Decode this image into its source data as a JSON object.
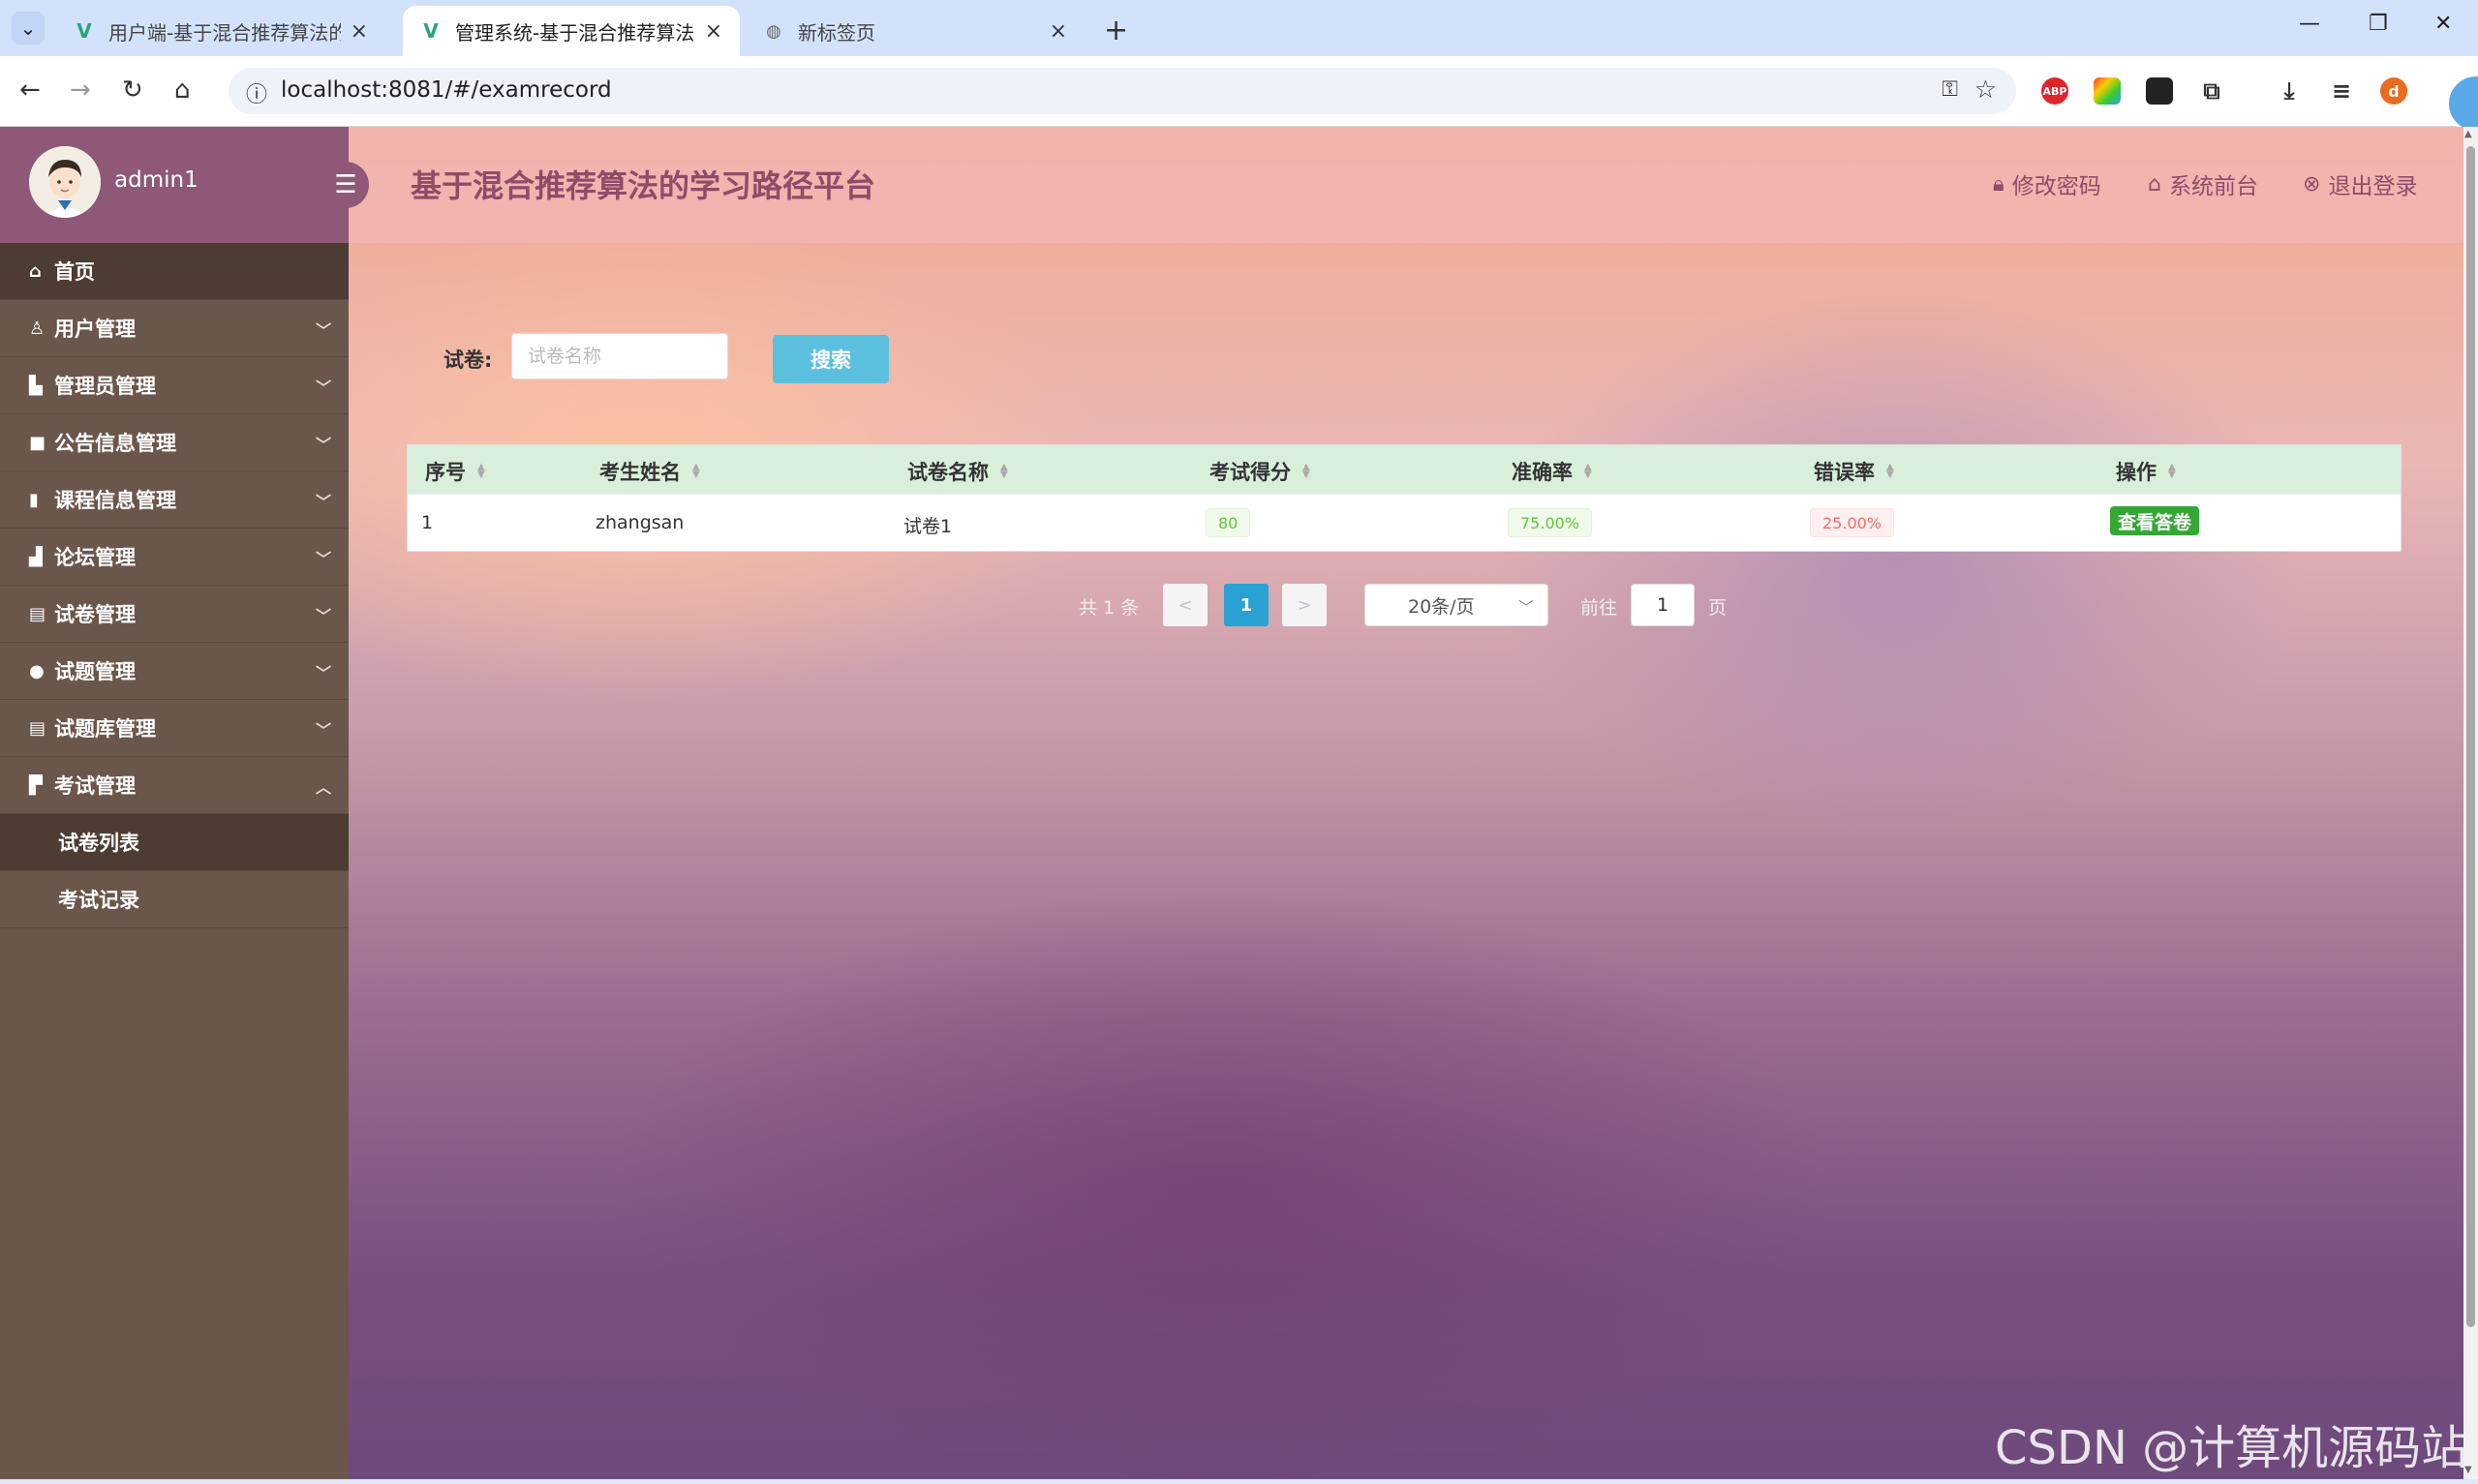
{
  "browser": {
    "tabs": [
      {
        "title": "用户端-基于混合推荐算法的学习路径平台",
        "active": false
      },
      {
        "title": "管理系统-基于混合推荐算法的学习路径平台",
        "active": true
      },
      {
        "title": "新标签页",
        "active": false
      }
    ],
    "url": "localhost:8081/#/examrecord",
    "profile_initial": "d",
    "ext_abp": "ABP"
  },
  "sidebar": {
    "username": "admin1",
    "menu": [
      {
        "label": "首页",
        "icon": "home-icon"
      },
      {
        "label": "用户管理",
        "icon": "user-icon"
      },
      {
        "label": "管理员管理",
        "icon": "admin-icon"
      },
      {
        "label": "公告信息管理",
        "icon": "notice-icon"
      },
      {
        "label": "课程信息管理",
        "icon": "course-icon"
      },
      {
        "label": "论坛管理",
        "icon": "forum-icon"
      },
      {
        "label": "试卷管理",
        "icon": "paper-icon"
      },
      {
        "label": "试题管理",
        "icon": "question-icon"
      },
      {
        "label": "试题库管理",
        "icon": "bank-icon"
      },
      {
        "label": "考试管理",
        "icon": "exam-icon"
      }
    ],
    "submenu": [
      {
        "label": "试卷列表"
      },
      {
        "label": "考试记录"
      }
    ]
  },
  "header": {
    "title": "基于混合推荐算法的学习路径平台",
    "change_password": "修改密码",
    "front_desk": "系统前台",
    "logout": "退出登录"
  },
  "search": {
    "label": "试卷:",
    "placeholder": "试卷名称",
    "button": "搜索"
  },
  "table": {
    "columns": [
      "序号",
      "考生姓名",
      "试卷名称",
      "考试得分",
      "准确率",
      "错误率",
      "操作"
    ],
    "rows": [
      {
        "index": "1",
        "name": "zhangsan",
        "paper": "试卷1",
        "score": "80",
        "accuracy": "75.00%",
        "error_rate": "25.00%",
        "action": "查看答卷"
      }
    ]
  },
  "pagination": {
    "total": "共 1 条",
    "prev": "<",
    "current": "1",
    "next": ">",
    "page_size": "20条/页",
    "goto": "前往",
    "goto_value": "1",
    "page_suffix": "页"
  },
  "watermark": "CSDN @计算机源码站"
}
